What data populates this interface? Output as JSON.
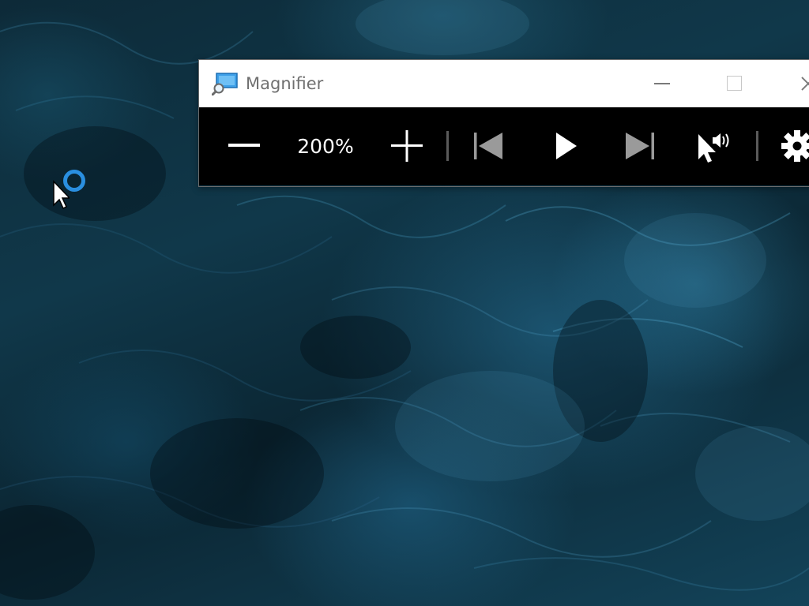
{
  "window": {
    "title": "Magnifier"
  },
  "toolbar": {
    "zoom_level": "200%"
  },
  "icons": {
    "app": "magnifier-app-icon",
    "zoom_out": "minus-icon",
    "zoom_in": "plus-icon",
    "previous": "skip-previous-icon",
    "play": "play-icon",
    "next": "skip-next-icon",
    "read_from_here": "pointer-speaker-icon",
    "settings": "gear-icon",
    "minimize": "minimize-icon",
    "maximize": "maximize-icon",
    "close": "close-icon",
    "cursor": "busy-cursor-icon"
  },
  "colors": {
    "toolbar_bg": "#000000",
    "titlebar_bg": "#ffffff",
    "title_text": "#6f6f6f",
    "busy_ring": "#2a8fe0",
    "desktop_accent": "#134359"
  }
}
